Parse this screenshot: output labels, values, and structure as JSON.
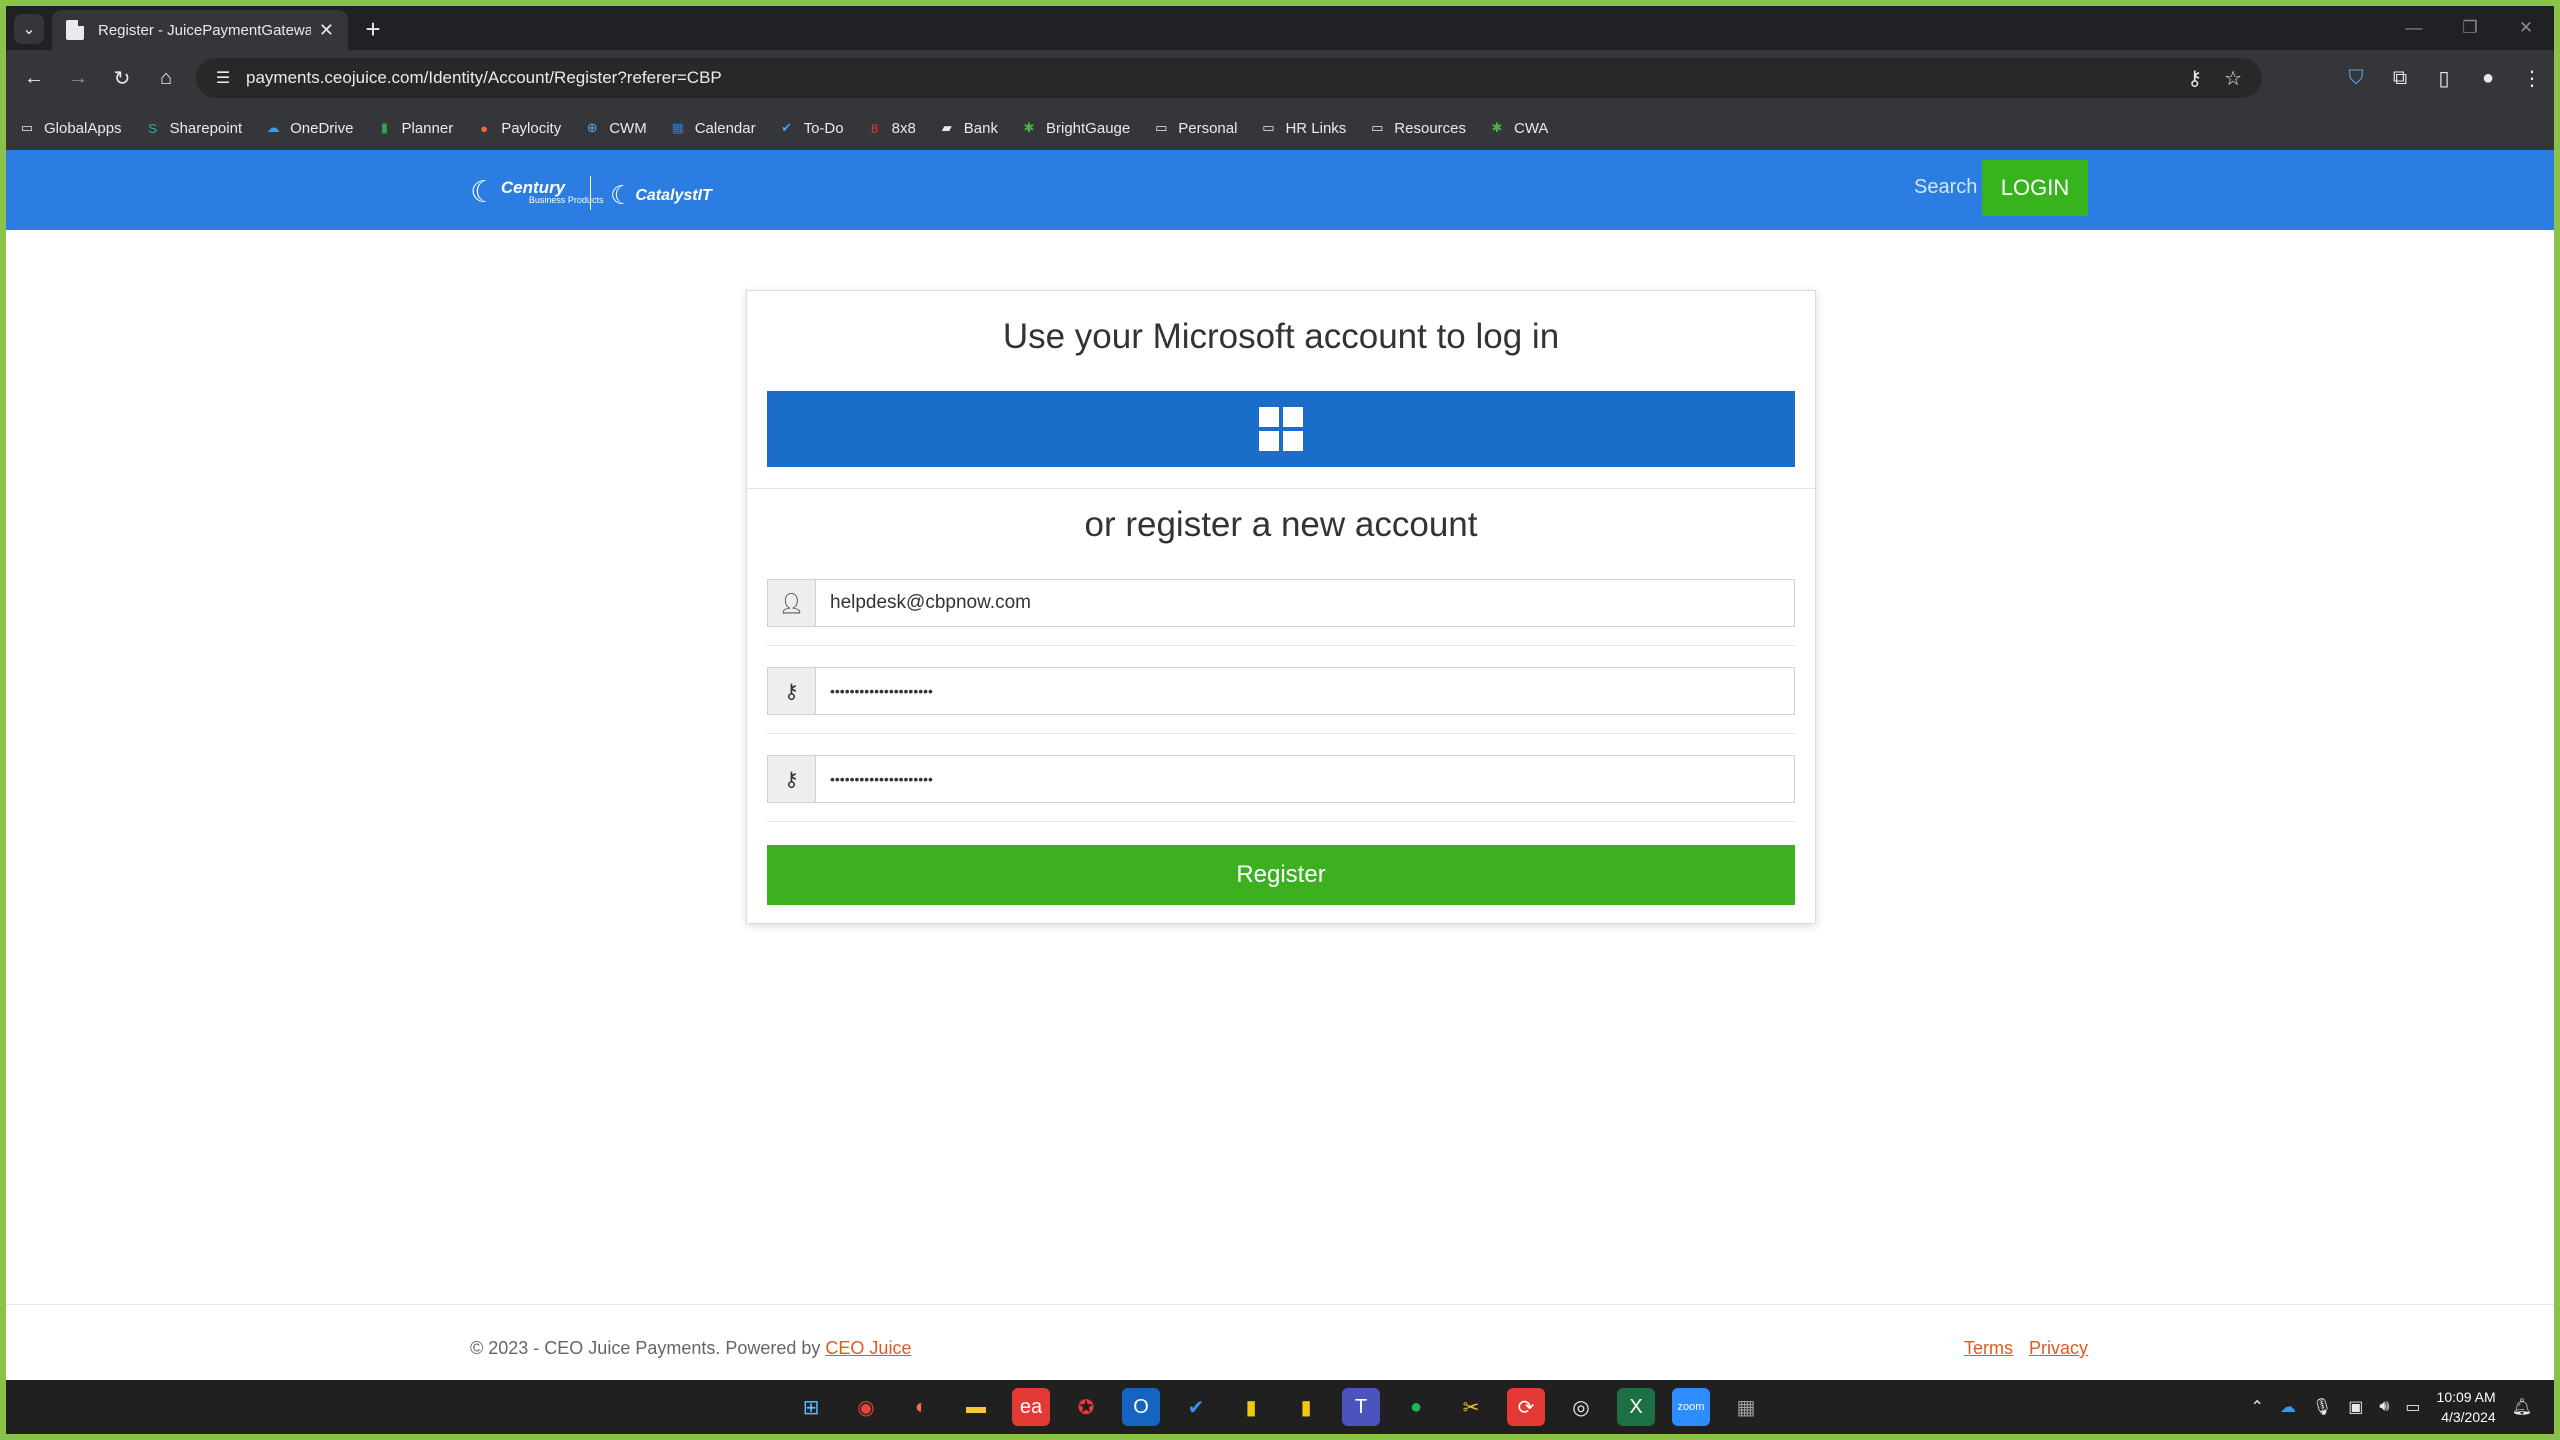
{
  "browser": {
    "tab_title": "Register - JuicePaymentGatewa",
    "tab_close": "✕",
    "new_tab": "+",
    "url": "payments.ceojuice.com/Identity/Account/Register?referer=CBP",
    "bookmarks": [
      {
        "label": "GlobalApps",
        "icon": "folder-icon",
        "glyph": "▭",
        "color": "#e8eaed"
      },
      {
        "label": "Sharepoint",
        "icon": "sharepoint-icon",
        "glyph": "S",
        "color": "#2bb3a6"
      },
      {
        "label": "OneDrive",
        "icon": "onedrive-icon",
        "glyph": "☁",
        "color": "#3a9bec"
      },
      {
        "label": "Planner",
        "icon": "planner-icon",
        "glyph": "▮",
        "color": "#31a14e"
      },
      {
        "label": "Paylocity",
        "icon": "paylocity-icon",
        "glyph": "●",
        "color": "#f26a33"
      },
      {
        "label": "CWM",
        "icon": "cwm-icon",
        "glyph": "⊕",
        "color": "#5aa9e6"
      },
      {
        "label": "Calendar",
        "icon": "calendar-icon",
        "glyph": "▦",
        "color": "#2a7ad6"
      },
      {
        "label": "To-Do",
        "icon": "todo-icon",
        "glyph": "✔",
        "color": "#4aa0f0"
      },
      {
        "label": "8x8",
        "icon": "8x8-icon",
        "glyph": "8",
        "color": "#e53935"
      },
      {
        "label": "Bank",
        "icon": "bank-icon",
        "glyph": "▰",
        "color": "#e8eaed"
      },
      {
        "label": "BrightGauge",
        "icon": "brightgauge-icon",
        "glyph": "✱",
        "color": "#4caf50"
      },
      {
        "label": "Personal",
        "icon": "folder-icon",
        "glyph": "▭",
        "color": "#e8eaed"
      },
      {
        "label": "HR Links",
        "icon": "folder-icon",
        "glyph": "▭",
        "color": "#e8eaed"
      },
      {
        "label": "Resources",
        "icon": "folder-icon",
        "glyph": "▭",
        "color": "#e8eaed"
      },
      {
        "label": "CWA",
        "icon": "cwa-icon",
        "glyph": "✱",
        "color": "#4caf50"
      }
    ]
  },
  "header": {
    "logo_century": "Century",
    "logo_century_sub": "Business Products",
    "logo_catalyst": "CatalystIT",
    "search_label": "Search",
    "login_label": "LOGIN"
  },
  "card": {
    "title": "Use your Microsoft account to log in",
    "subtitle": "or register a new account",
    "email_value": "helpdesk@cbpnow.com",
    "password_value": "•••••••••••••••••••••",
    "confirm_value": "•••••••••••••••••••••",
    "register_label": "Register"
  },
  "footer": {
    "copyright": "© 2023 - CEO Juice Payments. Powered by ",
    "powered_link": "CEO Juice",
    "terms": "Terms",
    "privacy": "Privacy"
  },
  "taskbar": {
    "time": "10:09 AM",
    "date": "4/3/2024",
    "apps": [
      {
        "name": "start-icon",
        "bg": "#202020",
        "glyph": "⊞",
        "color": "#4cc2ff"
      },
      {
        "name": "chrome-icon",
        "bg": "#202020",
        "glyph": "◉",
        "color": "#e94335"
      },
      {
        "name": "firefox-icon",
        "bg": "#202020",
        "glyph": "◐",
        "color": "#ff7139"
      },
      {
        "name": "file-explorer-icon",
        "bg": "#202020",
        "glyph": "▬",
        "color": "#f8c43b"
      },
      {
        "name": "ea-icon",
        "bg": "#e53935",
        "glyph": "ea",
        "color": "#ffffff"
      },
      {
        "name": "vivaldi-icon",
        "bg": "#202020",
        "glyph": "✪",
        "color": "#ef3939"
      },
      {
        "name": "outlook-icon",
        "bg": "#1565c0",
        "glyph": "O",
        "color": "#ffffff"
      },
      {
        "name": "todo-app-icon",
        "bg": "#202020",
        "glyph": "✔",
        "color": "#3b8ef0"
      },
      {
        "name": "powerbi-icon",
        "bg": "#202020",
        "glyph": "▮",
        "color": "#f2c811"
      },
      {
        "name": "powerbi-desktop-icon",
        "bg": "#202020",
        "glyph": "▮",
        "color": "#f2c811"
      },
      {
        "name": "teams-icon",
        "bg": "#4b53bc",
        "glyph": "T",
        "color": "#ffffff"
      },
      {
        "name": "spotify-icon",
        "bg": "#202020",
        "glyph": "●",
        "color": "#1db954"
      },
      {
        "name": "snip-tool-icon",
        "bg": "#202020",
        "glyph": "✂",
        "color": "#f2c811"
      },
      {
        "name": "remote-icon",
        "bg": "#e53935",
        "glyph": "⟳",
        "color": "#ffffff"
      },
      {
        "name": "obs-icon",
        "bg": "#202020",
        "glyph": "◎",
        "color": "#e8eaed"
      },
      {
        "name": "excel-icon",
        "bg": "#1d7044",
        "glyph": "X",
        "color": "#ffffff"
      },
      {
        "name": "zoom-icon",
        "bg": "#2d8cff",
        "glyph": "zoom",
        "color": "#ffffff"
      },
      {
        "name": "calculator-icon",
        "bg": "#202020",
        "glyph": "▦",
        "color": "#9aa0a6"
      }
    ]
  }
}
